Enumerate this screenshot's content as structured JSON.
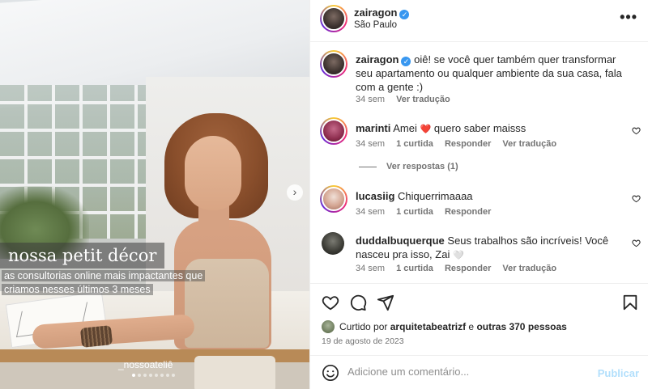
{
  "post": {
    "overlay_title": "nossa petit décor",
    "overlay_line1": "as consultorias online mais impactantes que",
    "overlay_line2": "criamos nesses últimos 3 meses",
    "watermark": "_nossoateliê"
  },
  "header": {
    "username": "zairagon",
    "location": "São Paulo",
    "more_label": "•••"
  },
  "caption": {
    "username": "zairagon",
    "text": "oiê! se você quer também quer transformar seu apartamento ou qualquer ambiente da sua casa, fala com a gente :)",
    "time": "34 sem",
    "translate": "Ver tradução"
  },
  "comments": [
    {
      "username": "marinti",
      "text_before": "Amei",
      "emoji": "❤️",
      "text_after": "quero saber maisss",
      "time": "34 sem",
      "likes": "1 curtida",
      "reply": "Responder",
      "translate": "Ver tradução",
      "view_replies": "Ver respostas (1)"
    },
    {
      "username": "lucasiig",
      "text": "Chiquerrimaaaa",
      "time": "34 sem",
      "likes": "1 curtida",
      "reply": "Responder"
    },
    {
      "username": "duddalbuquerque",
      "text": "Seus trabalhos são incríveis! Você nasceu pra isso, Zai",
      "emoji": "🤍",
      "time": "34 sem",
      "likes": "1 curtida",
      "reply": "Responder",
      "translate": "Ver tradução"
    }
  ],
  "likes_line": {
    "prefix": "Curtido por",
    "user": "arquitetabeatrizf",
    "middle": "e",
    "others": "outras 370 pessoas"
  },
  "date": "19 de agosto de 2023",
  "composer": {
    "placeholder": "Adicione um comentário...",
    "post_label": "Publicar"
  },
  "icons": {
    "verified": "verified-badge-icon",
    "like": "heart-icon",
    "comment": "comment-icon",
    "share": "paper-plane-icon",
    "save": "bookmark-icon",
    "emoji": "smiley-icon",
    "next": "chevron-right-icon"
  },
  "colors": {
    "verified": "#3897f0",
    "muted": "#737373",
    "post_button_disabled": "#b2dffc"
  },
  "carousel": {
    "total": 8,
    "current": 1
  }
}
